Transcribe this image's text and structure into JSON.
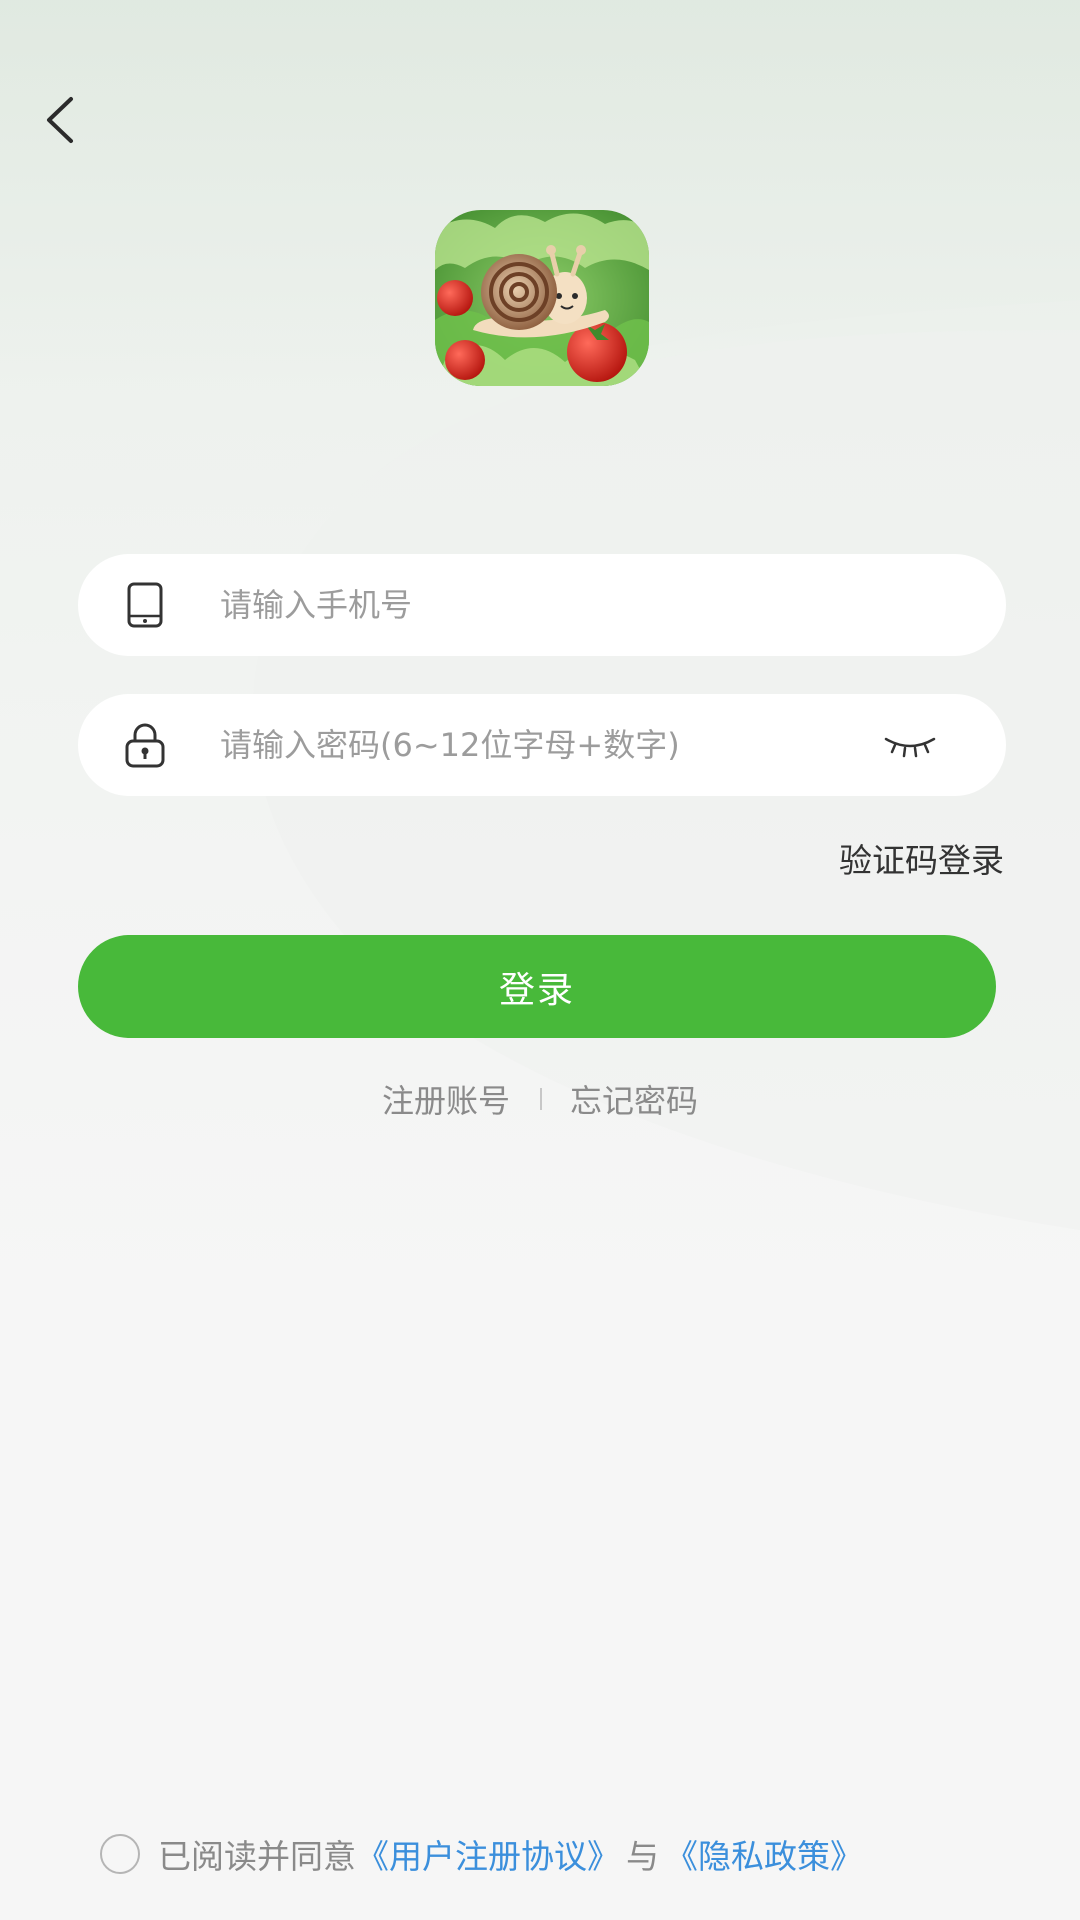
{
  "header": {
    "back_icon": "chevron-left-icon"
  },
  "logo": {
    "icon": "snail-on-lettuce-app-logo"
  },
  "phone": {
    "icon": "smartphone-icon",
    "value": "",
    "placeholder": "请输入手机号"
  },
  "password": {
    "icon": "lock-icon",
    "value": "",
    "placeholder": "请输入密码(6~12位字母+数字)",
    "toggle_icon": "eye-closed-icon"
  },
  "code_login_label": "验证码登录",
  "login_button_label": "登录",
  "links": {
    "register": "注册账号",
    "forgot": "忘记密码"
  },
  "agreement": {
    "prefix": "已阅读并同意",
    "user_agreement": "《用户注册协议》",
    "joiner": "与",
    "privacy_policy": "《隐私政策》",
    "checked": false
  },
  "colors": {
    "accent_green": "#48b93a",
    "link_blue": "#3b8fdc",
    "background": "#f6f6f6"
  }
}
